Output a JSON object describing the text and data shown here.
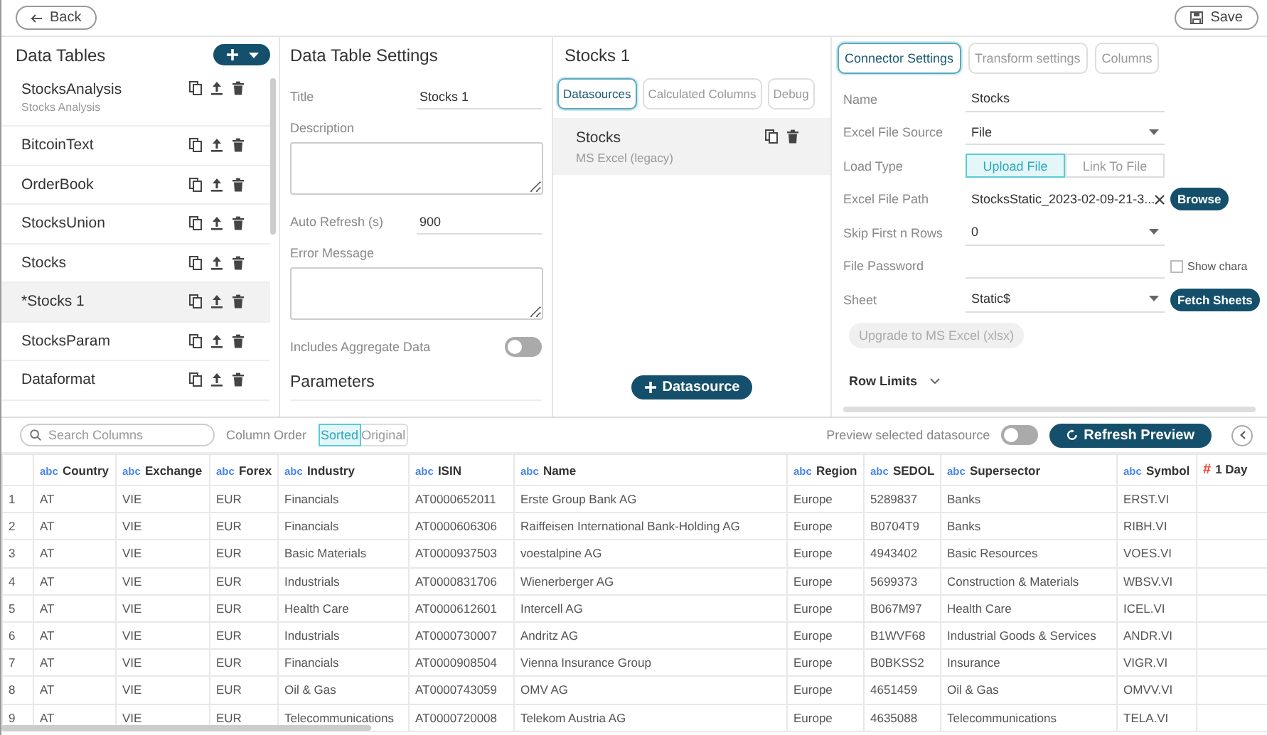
{
  "toolbar": {
    "back": "Back",
    "save": "Save"
  },
  "data_tables": {
    "title": "Data Tables",
    "items": [
      {
        "name": "StocksAnalysis",
        "subtitle": "Stocks Analysis",
        "selected": false
      },
      {
        "name": "BitcoinText",
        "selected": false
      },
      {
        "name": "OrderBook",
        "selected": false
      },
      {
        "name": "StocksUnion",
        "selected": false
      },
      {
        "name": "Stocks",
        "selected": false
      },
      {
        "name": "*Stocks 1",
        "selected": true
      },
      {
        "name": "StocksParam",
        "selected": false
      },
      {
        "name": "Dataformat",
        "selected": false
      }
    ]
  },
  "settings": {
    "title": "Data Table Settings",
    "fields": [
      {
        "kind": "text",
        "label": "Title",
        "value": "Stocks 1"
      },
      {
        "kind": "textarea",
        "label": "Description"
      },
      {
        "kind": "text",
        "label": "Auto Refresh (s)",
        "value": "900"
      },
      {
        "kind": "textarea",
        "label": "Error Message"
      },
      {
        "kind": "toggle",
        "label": "Includes Aggregate Data",
        "on": false
      }
    ],
    "parameters_title": "Parameters"
  },
  "datasources": {
    "title": "Stocks 1",
    "tabs": [
      {
        "label": "Datasources",
        "selected": true
      },
      {
        "label": "Calculated Columns",
        "selected": false
      },
      {
        "label": "Debug",
        "selected": false
      }
    ],
    "items": [
      {
        "name": "Stocks",
        "type": "MS Excel (legacy)",
        "selected": true
      }
    ],
    "add_button": "Datasource"
  },
  "connector": {
    "tabs": [
      {
        "label": "Connector Settings",
        "selected": true
      },
      {
        "label": "Transform settings",
        "selected": false
      },
      {
        "label": "Columns",
        "selected": false
      }
    ],
    "fields": [
      {
        "kind": "text",
        "label": "Name",
        "value": "Stocks"
      },
      {
        "kind": "select",
        "label": "Excel File Source",
        "value": "File"
      },
      {
        "kind": "segmented",
        "label": "Load Type",
        "options": [
          {
            "label": "Upload File",
            "selected": true
          },
          {
            "label": "Link To File",
            "selected": false
          }
        ]
      },
      {
        "kind": "file",
        "label": "Excel File Path",
        "value": "StocksStatic_2023-02-09-21-3...",
        "button": "Browse"
      },
      {
        "kind": "select",
        "label": "Skip First n Rows",
        "value": "0"
      },
      {
        "kind": "password",
        "label": "File Password",
        "checkbox_label": "Show chara",
        "checked": false
      },
      {
        "kind": "select",
        "label": "Sheet",
        "value": "Static$",
        "button": "Fetch Sheets"
      }
    ],
    "upgrade": {
      "label": "Upgrade to MS Excel (xlsx)",
      "disabled": true
    },
    "row_limits": "Row Limits"
  },
  "preview": {
    "search_placeholder": "Search Columns",
    "column_order_label": "Column Order",
    "order_options": [
      {
        "label": "Sorted",
        "selected": true
      },
      {
        "label": "Original",
        "selected": false
      }
    ],
    "preview_selected_label": "Preview selected datasource",
    "preview_selected_on": false,
    "refresh_button": "Refresh Preview",
    "table": {
      "columns": [
        {
          "kind": "index"
        },
        {
          "kind": "text",
          "type_label": "abc",
          "name": "Country"
        },
        {
          "kind": "text",
          "type_label": "abc",
          "name": "Exchange"
        },
        {
          "kind": "text",
          "type_label": "abc",
          "name": "Forex"
        },
        {
          "kind": "text",
          "type_label": "abc",
          "name": "Industry"
        },
        {
          "kind": "text",
          "type_label": "abc",
          "name": "ISIN"
        },
        {
          "kind": "text",
          "type_label": "abc",
          "name": "Name"
        },
        {
          "kind": "text",
          "type_label": "abc",
          "name": "Region"
        },
        {
          "kind": "text",
          "type_label": "abc",
          "name": "SEDOL"
        },
        {
          "kind": "text",
          "type_label": "abc",
          "name": "Supersector"
        },
        {
          "kind": "text",
          "type_label": "abc",
          "name": "Symbol"
        },
        {
          "kind": "number",
          "type_label": "#",
          "name": "1 Day"
        }
      ],
      "rows": [
        [
          "1",
          "AT",
          "VIE",
          "EUR",
          "Financials",
          "AT0000652011",
          "Erste Group Bank AG",
          "Europe",
          "5289837",
          "Banks",
          "ERST.VI"
        ],
        [
          "2",
          "AT",
          "VIE",
          "EUR",
          "Financials",
          "AT0000606306",
          "Raiffeisen International Bank-Holding AG",
          "Europe",
          "B0704T9",
          "Banks",
          "RIBH.VI"
        ],
        [
          "3",
          "AT",
          "VIE",
          "EUR",
          "Basic Materials",
          "AT0000937503",
          "voestalpine AG",
          "Europe",
          "4943402",
          "Basic Resources",
          "VOES.VI"
        ],
        [
          "4",
          "AT",
          "VIE",
          "EUR",
          "Industrials",
          "AT0000831706",
          "Wienerberger AG",
          "Europe",
          "5699373",
          "Construction & Materials",
          "WBSV.VI"
        ],
        [
          "5",
          "AT",
          "VIE",
          "EUR",
          "Health Care",
          "AT0000612601",
          "Intercell AG",
          "Europe",
          "B067M97",
          "Health Care",
          "ICEL.VI"
        ],
        [
          "6",
          "AT",
          "VIE",
          "EUR",
          "Industrials",
          "AT0000730007",
          "Andritz AG",
          "Europe",
          "B1WVF68",
          "Industrial Goods & Services",
          "ANDR.VI"
        ],
        [
          "7",
          "AT",
          "VIE",
          "EUR",
          "Financials",
          "AT0000908504",
          "Vienna Insurance Group",
          "Europe",
          "B0BKSS2",
          "Insurance",
          "VIGR.VI"
        ],
        [
          "8",
          "AT",
          "VIE",
          "EUR",
          "Oil & Gas",
          "AT0000743059",
          "OMV AG",
          "Europe",
          "4651459",
          "Oil & Gas",
          "OMVV.VI"
        ],
        [
          "9",
          "AT",
          "VIE",
          "EUR",
          "Telecommunications",
          "AT0000720008",
          "Telekom Austria AG",
          "Europe",
          "4635088",
          "Telecommunications",
          "TELA.VI"
        ]
      ]
    }
  }
}
